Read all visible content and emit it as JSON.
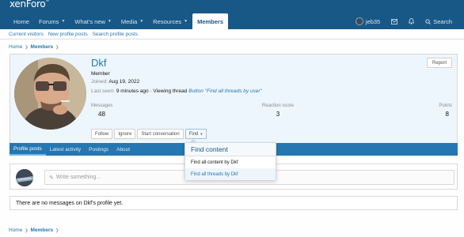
{
  "brand": {
    "logo": "xenForo",
    "logo_sup": "®"
  },
  "nav": {
    "tabs": [
      {
        "label": "Home"
      },
      {
        "label": "Forums",
        "caret": true
      },
      {
        "label": "What's new",
        "caret": true
      },
      {
        "label": "Media",
        "caret": true
      },
      {
        "label": "Resources",
        "caret": true
      },
      {
        "label": "Members",
        "active": true
      }
    ],
    "user": "jeb35",
    "search": "Search"
  },
  "subnav": [
    "Current visitors",
    "New profile posts",
    "Search profile posts"
  ],
  "breadcrumb": {
    "home": "Home",
    "section": "Members"
  },
  "profile": {
    "username": "Dkf",
    "title": "Member",
    "joined_label": "Joined:",
    "joined_value": "Aug 19, 2022",
    "last_seen_label": "Last seen:",
    "last_seen_value": "9 minutes ago · Viewing thread",
    "last_seen_thread": "Button \"Find all threads by user\"",
    "report": "Report",
    "stats": [
      {
        "label": "Messages",
        "value": "48"
      },
      {
        "label": "Reaction score",
        "value": "3"
      },
      {
        "label": "Points",
        "value": "8"
      }
    ],
    "actions": {
      "follow": "Follow",
      "ignore": "Ignore",
      "start_conversation": "Start conversation",
      "find": "Find"
    }
  },
  "tabs": [
    "Profile posts",
    "Latest activity",
    "Postings",
    "About"
  ],
  "dropdown": {
    "header": "Find content",
    "items": [
      "Find all content by Dkf",
      "Find all threads by Dkf"
    ]
  },
  "composer": {
    "placeholder": "Write something..."
  },
  "empty_message": "There are no messages on Dkf's profile yet.",
  "colors": {
    "header": "#185886",
    "accent": "#2577b1",
    "card_bg": "#edf6fd"
  }
}
